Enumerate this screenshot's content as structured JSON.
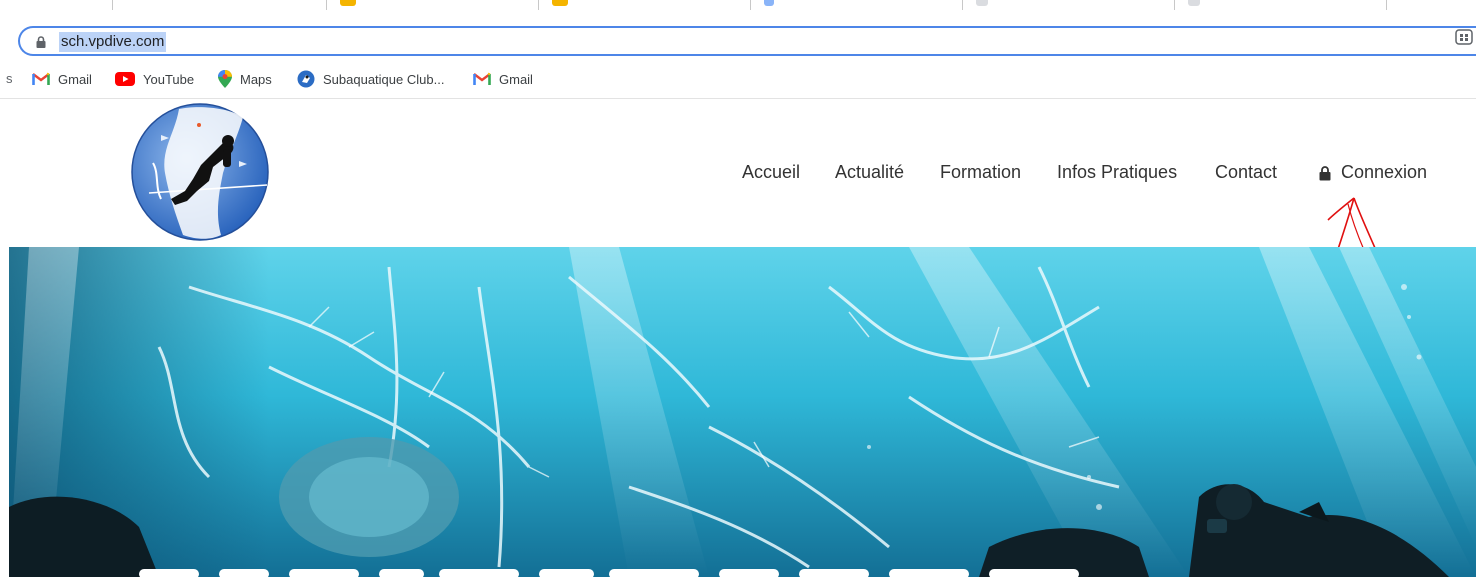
{
  "browser": {
    "address_bar": {
      "url": "sch.vpdive.com"
    },
    "bookmarks": [
      {
        "label": "Gmail",
        "icon": "gmail-icon"
      },
      {
        "label": "YouTube",
        "icon": "youtube-icon"
      },
      {
        "label": "Maps",
        "icon": "maps-icon"
      },
      {
        "label": "Subaquatique Club...",
        "icon": "club-icon"
      },
      {
        "label": "Gmail",
        "icon": "gmail-icon"
      }
    ],
    "bookmarks_overflow": "s"
  },
  "site": {
    "nav": [
      {
        "label": "Accueil"
      },
      {
        "label": "Actualité"
      },
      {
        "label": "Formation"
      },
      {
        "label": "Infos Pratiques"
      },
      {
        "label": "Contact"
      },
      {
        "label": "Connexion",
        "icon": "lock-icon"
      }
    ]
  },
  "colors": {
    "omnibox_border": "#4d86e8",
    "url_highlight": "#bcd3f7",
    "annotation_red": "#e01010",
    "hero_water": "#2fb8d8"
  }
}
